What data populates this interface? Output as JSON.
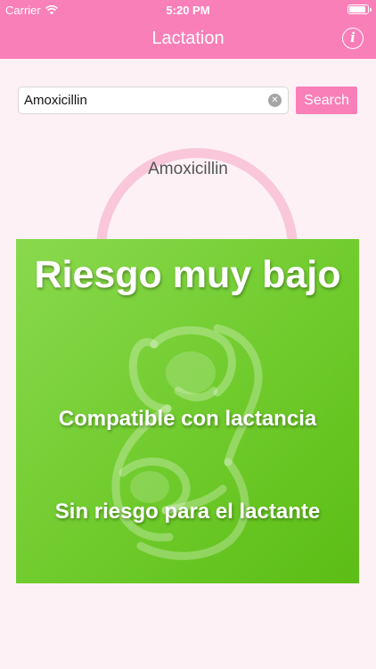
{
  "status_bar": {
    "carrier": "Carrier",
    "time": "5:20 PM",
    "icons": [
      "wifi-icon",
      "battery-icon"
    ]
  },
  "nav": {
    "title": "Lactation",
    "info_icon": "info-icon",
    "info_glyph": "i"
  },
  "search": {
    "value": "Amoxicillin",
    "clear_icon": "clear-icon",
    "button_label": "Search"
  },
  "result": {
    "drug_name": "Amoxicillin",
    "risk_level": "Riesgo muy bajo",
    "lactation_compatibility": "Compatible con lactancia",
    "infant_risk": "Sin riesgo para el lactante",
    "card_color": "#6fcb2c"
  },
  "colors": {
    "brand_pink": "#f97fb8",
    "background": "#fdf1f6",
    "watermark": "#f9c6da"
  }
}
